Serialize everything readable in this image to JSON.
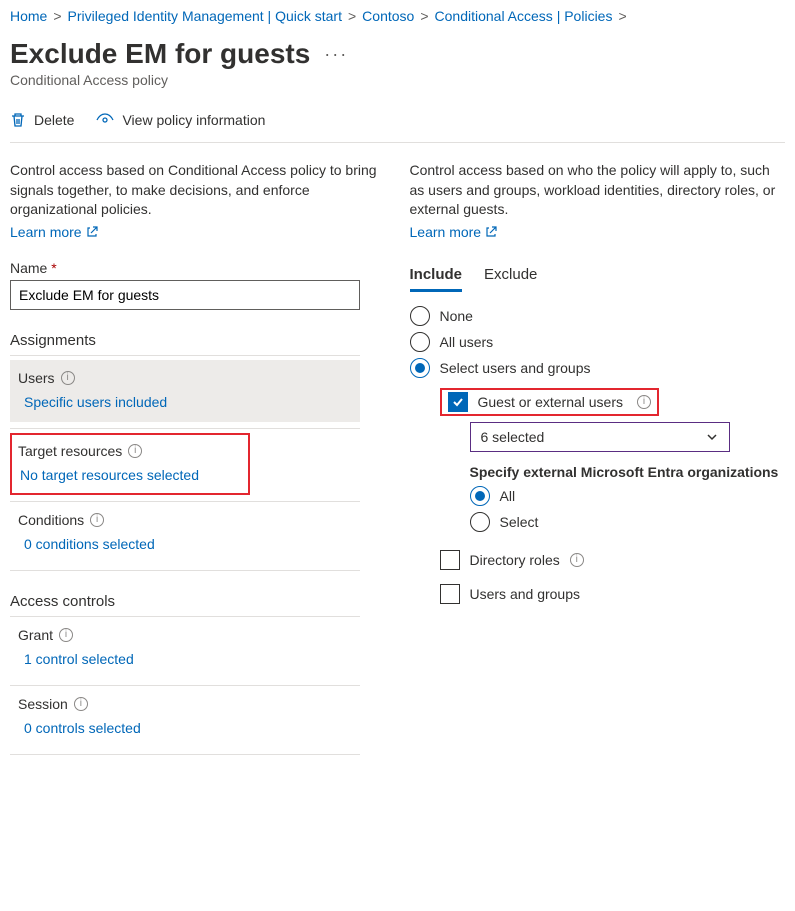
{
  "breadcrumb": {
    "items": [
      "Home",
      "Privileged Identity Management | Quick start",
      "Contoso",
      "Conditional Access | Policies"
    ]
  },
  "page": {
    "title": "Exclude EM for guests",
    "subtitle": "Conditional Access policy"
  },
  "toolbar": {
    "delete": "Delete",
    "view_info": "View policy information"
  },
  "left": {
    "description": "Control access based on Conditional Access policy to bring signals together, to make decisions, and enforce organizational policies.",
    "learn_more": "Learn more",
    "name_label": "Name",
    "name_value": "Exclude EM for guests",
    "assignments_header": "Assignments",
    "users": {
      "label": "Users",
      "link": "Specific users included"
    },
    "target": {
      "label": "Target resources",
      "link": "No target resources selected"
    },
    "conditions": {
      "label": "Conditions",
      "link": "0 conditions selected"
    },
    "access_controls_header": "Access controls",
    "grant": {
      "label": "Grant",
      "link": "1 control selected"
    },
    "session": {
      "label": "Session",
      "link": "0 controls selected"
    }
  },
  "right": {
    "description": "Control access based on who the policy will apply to, such as users and groups, workload identities, directory roles, or external guests.",
    "learn_more": "Learn more",
    "tabs": {
      "include": "Include",
      "exclude": "Exclude"
    },
    "radios": {
      "none": "None",
      "all": "All users",
      "select": "Select users and groups"
    },
    "checks": {
      "guest": "Guest or external users",
      "dropdown": "6 selected",
      "specify_header": "Specify external Microsoft Entra organizations",
      "org_all": "All",
      "org_select": "Select",
      "dir_roles": "Directory roles",
      "users_groups": "Users and groups"
    }
  }
}
